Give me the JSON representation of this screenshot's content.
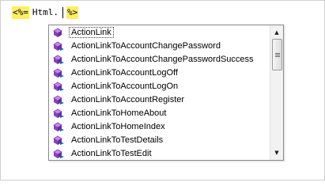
{
  "editor": {
    "open_tag": "<%=",
    "code": "Html.",
    "close_tag": "%>"
  },
  "completion": {
    "items": [
      {
        "label": "ActionLink",
        "icon": "method-icon",
        "selected": true
      },
      {
        "label": "ActionLinkToAccountChangePassword",
        "icon": "extension-method-icon"
      },
      {
        "label": "ActionLinkToAccountChangePasswordSuccess",
        "icon": "extension-method-icon"
      },
      {
        "label": "ActionLinkToAccountLogOff",
        "icon": "extension-method-icon"
      },
      {
        "label": "ActionLinkToAccountLogOn",
        "icon": "extension-method-icon"
      },
      {
        "label": "ActionLinkToAccountRegister",
        "icon": "extension-method-icon"
      },
      {
        "label": "ActionLinkToHomeAbout",
        "icon": "extension-method-icon"
      },
      {
        "label": "ActionLinkToHomeIndex",
        "icon": "extension-method-icon"
      },
      {
        "label": "ActionLinkToTestDetails",
        "icon": "extension-method-icon"
      },
      {
        "label": "ActionLinkToTestEdit",
        "icon": "extension-method-icon"
      }
    ]
  },
  "colors": {
    "tag_highlight": "#ffee62",
    "method_icon": "#8a3fc0"
  }
}
